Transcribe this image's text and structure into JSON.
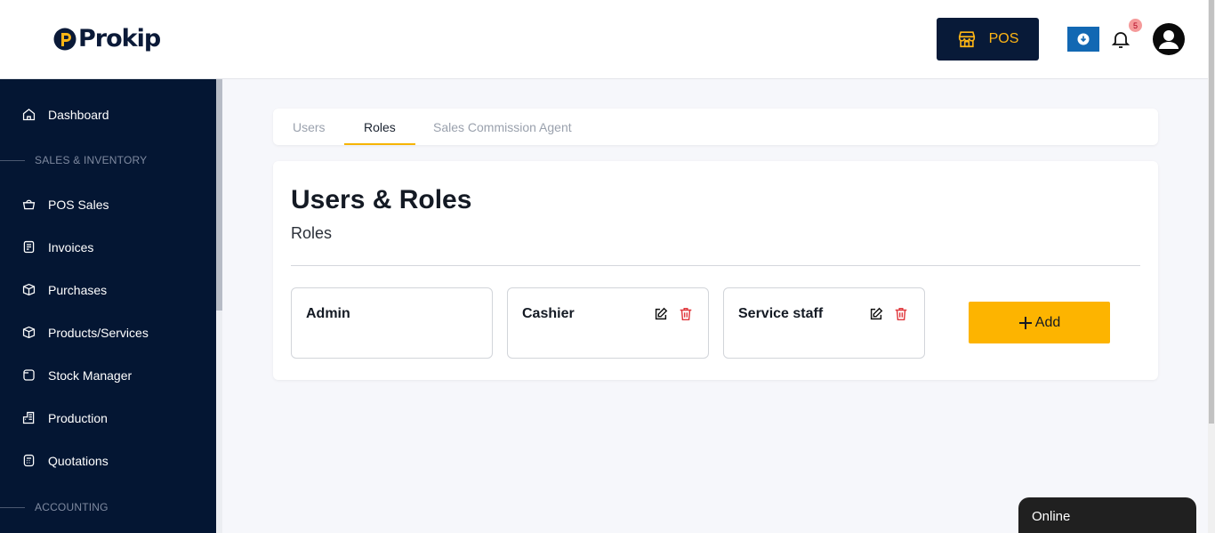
{
  "header": {
    "logo_text": "Prokip",
    "pos_label": "POS",
    "notification_count": "5"
  },
  "sidebar": {
    "items": [
      {
        "label": "Dashboard",
        "icon": "home-icon"
      },
      {
        "label": "POS Sales",
        "icon": "basket-icon"
      },
      {
        "label": "Invoices",
        "icon": "invoice-icon"
      },
      {
        "label": "Purchases",
        "icon": "box-icon"
      },
      {
        "label": "Products/Services",
        "icon": "cube-icon"
      },
      {
        "label": "Stock Manager",
        "icon": "stock-icon"
      },
      {
        "label": "Production",
        "icon": "factory-icon"
      },
      {
        "label": "Quotations",
        "icon": "calculator-icon"
      }
    ],
    "sections": [
      "SALES & INVENTORY",
      "ACCOUNTING"
    ]
  },
  "tabs": [
    {
      "label": "Users",
      "active": false
    },
    {
      "label": "Roles",
      "active": true
    },
    {
      "label": "Sales Commission Agent",
      "active": false
    }
  ],
  "main": {
    "title": "Users & Roles",
    "subtitle": "Roles",
    "roles": [
      {
        "name": "Admin",
        "editable": false
      },
      {
        "name": "Cashier",
        "editable": true
      },
      {
        "name": "Service staff",
        "editable": true
      }
    ],
    "add_label": "Add"
  },
  "chat": {
    "status": "Online"
  },
  "colors": {
    "brand_dark": "#041633",
    "accent": "#fdb400",
    "delete": "#e0393e",
    "download": "#1268b3"
  }
}
